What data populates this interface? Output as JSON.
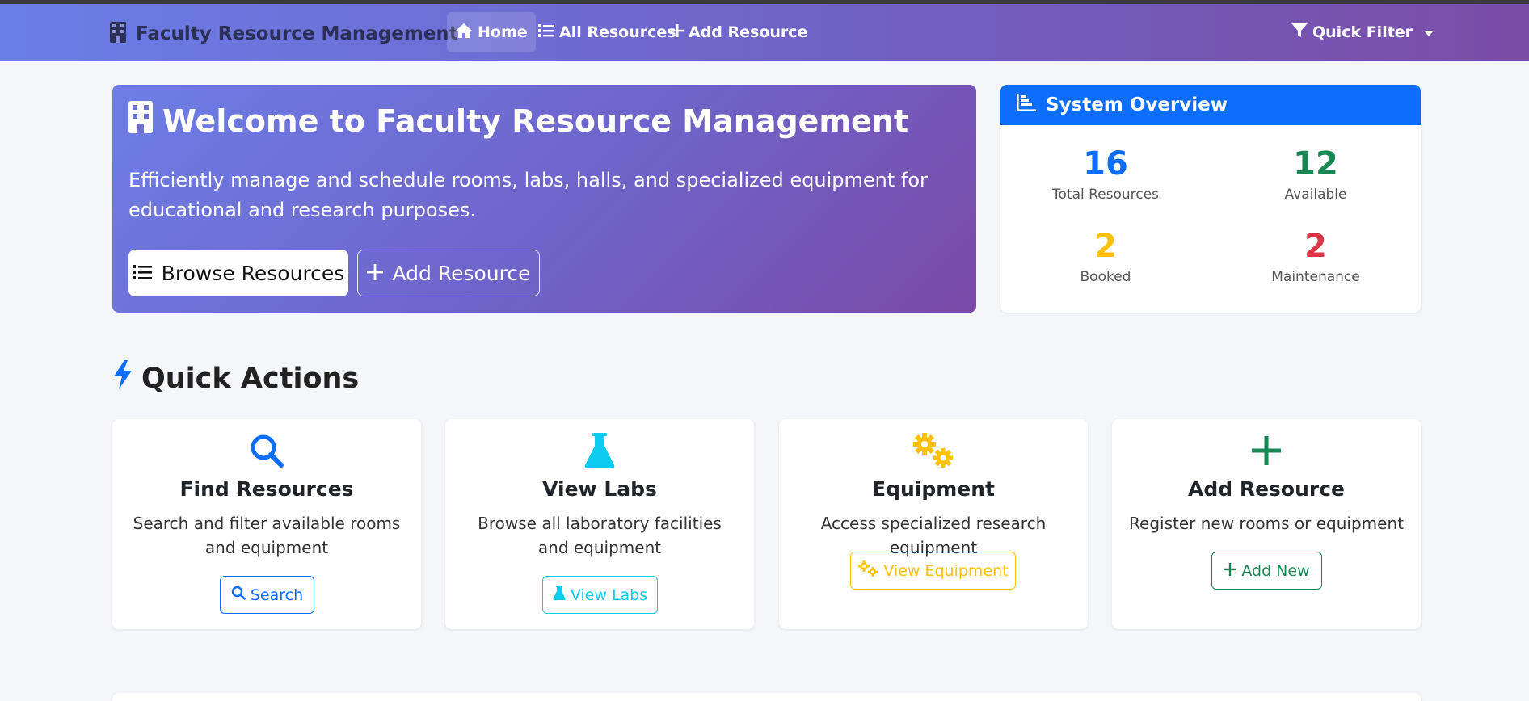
{
  "navbar": {
    "brand": "Faculty Resource Management",
    "items": [
      {
        "label": "Home",
        "icon": "home-icon",
        "active": true
      },
      {
        "label": "All Resources",
        "icon": "list-icon",
        "active": false
      },
      {
        "label": "Add Resource",
        "icon": "plus-icon",
        "active": false
      }
    ],
    "quick_filter": "Quick Filter"
  },
  "hero": {
    "title": "Welcome to Faculty Resource Management",
    "description": "Efficiently manage and schedule rooms, labs, halls, and specialized equipment for educational and research purposes.",
    "browse_button": "Browse Resources",
    "add_button": "Add Resource"
  },
  "overview": {
    "title": "System Overview",
    "stats": [
      {
        "value": "16",
        "label": "Total Resources",
        "color": "#0d6efd"
      },
      {
        "value": "12",
        "label": "Available",
        "color": "#198754"
      },
      {
        "value": "2",
        "label": "Booked",
        "color": "#ffc107"
      },
      {
        "value": "2",
        "label": "Maintenance",
        "color": "#dc3545"
      }
    ]
  },
  "quick_actions": {
    "title": "Quick Actions",
    "cards": [
      {
        "title": "Find Resources",
        "description": "Search and filter available rooms and equipment",
        "button": "Search",
        "icon": "search-icon",
        "color": "#0d6efd"
      },
      {
        "title": "View Labs",
        "description": "Browse all laboratory facilities and equipment",
        "button": "View Labs",
        "icon": "flask-icon",
        "color": "#0dcaf0"
      },
      {
        "title": "Equipment",
        "description": "Access specialized research equipment",
        "button": "View Equipment",
        "icon": "gears-icon",
        "color": "#ffc107"
      },
      {
        "title": "Add Resource",
        "description": "Register new rooms or equipment",
        "button": "Add New",
        "icon": "plus-icon",
        "color": "#198754"
      }
    ]
  }
}
